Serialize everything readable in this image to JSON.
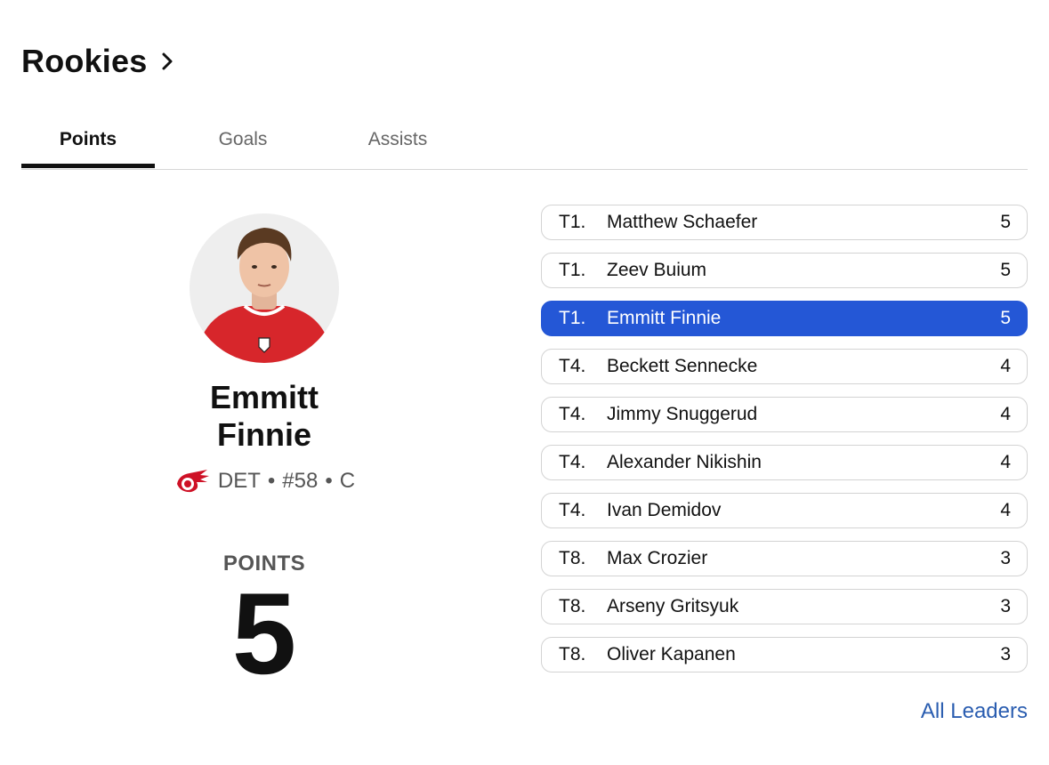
{
  "header": {
    "title": "Rookies",
    "chevron_icon": "chevron-right-icon"
  },
  "tabs": [
    {
      "label": "Points",
      "active": true
    },
    {
      "label": "Goals",
      "active": false
    },
    {
      "label": "Assists",
      "active": false
    }
  ],
  "featured": {
    "first_name": "Emmitt",
    "last_name": "Finnie",
    "team": "DET",
    "sep1": "•",
    "number": "#58",
    "sep2": "•",
    "position": "C",
    "team_logo_icon": "red-wings-logo-icon",
    "stat_label": "POINTS",
    "stat_value": "5"
  },
  "leaders": [
    {
      "rank": "T1.",
      "name": "Matthew Schaefer",
      "value": "5",
      "highlighted": false
    },
    {
      "rank": "T1.",
      "name": "Zeev Buium",
      "value": "5",
      "highlighted": false
    },
    {
      "rank": "T1.",
      "name": "Emmitt Finnie",
      "value": "5",
      "highlighted": true
    },
    {
      "rank": "T4.",
      "name": "Beckett Sennecke",
      "value": "4",
      "highlighted": false
    },
    {
      "rank": "T4.",
      "name": "Jimmy Snuggerud",
      "value": "4",
      "highlighted": false
    },
    {
      "rank": "T4.",
      "name": "Alexander Nikishin",
      "value": "4",
      "highlighted": false
    },
    {
      "rank": "T4.",
      "name": "Ivan Demidov",
      "value": "4",
      "highlighted": false
    },
    {
      "rank": "T8.",
      "name": "Max Crozier",
      "value": "3",
      "highlighted": false
    },
    {
      "rank": "T8.",
      "name": "Arseny Gritsyuk",
      "value": "3",
      "highlighted": false
    },
    {
      "rank": "T8.",
      "name": "Oliver Kapanen",
      "value": "3",
      "highlighted": false
    }
  ],
  "all_leaders_link": "All Leaders",
  "colors": {
    "accent": "#2457d6",
    "link": "#2a5db0",
    "jersey_red": "#d7262b"
  }
}
